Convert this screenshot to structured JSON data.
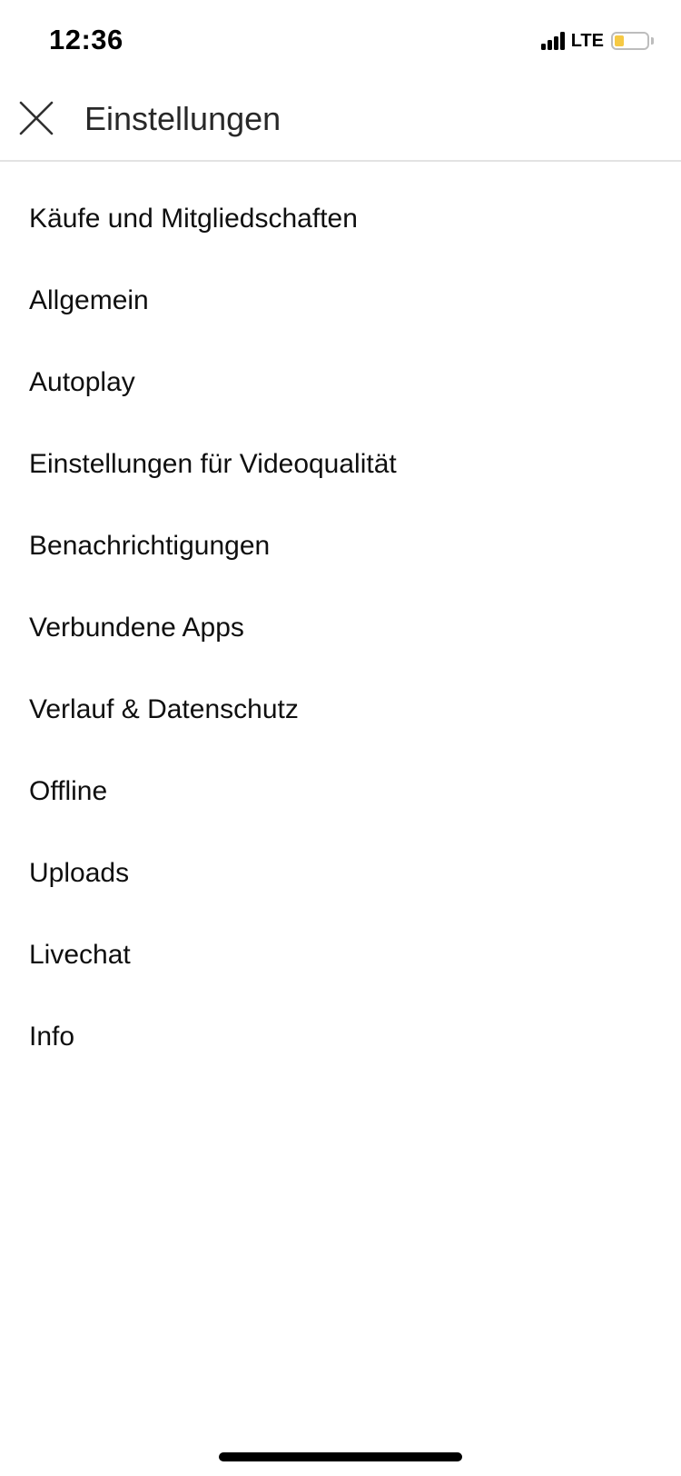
{
  "status_bar": {
    "time": "12:36",
    "network": "LTE",
    "battery_color": "#f6c944"
  },
  "header": {
    "close_icon": "close-icon",
    "title": "Einstellungen"
  },
  "menu": {
    "items": [
      {
        "label": "Käufe und Mitgliedschaften"
      },
      {
        "label": "Allgemein"
      },
      {
        "label": "Autoplay"
      },
      {
        "label": "Einstellungen für Videoqualität"
      },
      {
        "label": "Benachrichtigungen"
      },
      {
        "label": "Verbundene Apps"
      },
      {
        "label": "Verlauf & Datenschutz"
      },
      {
        "label": "Offline"
      },
      {
        "label": "Uploads"
      },
      {
        "label": "Livechat"
      },
      {
        "label": "Info"
      }
    ]
  }
}
